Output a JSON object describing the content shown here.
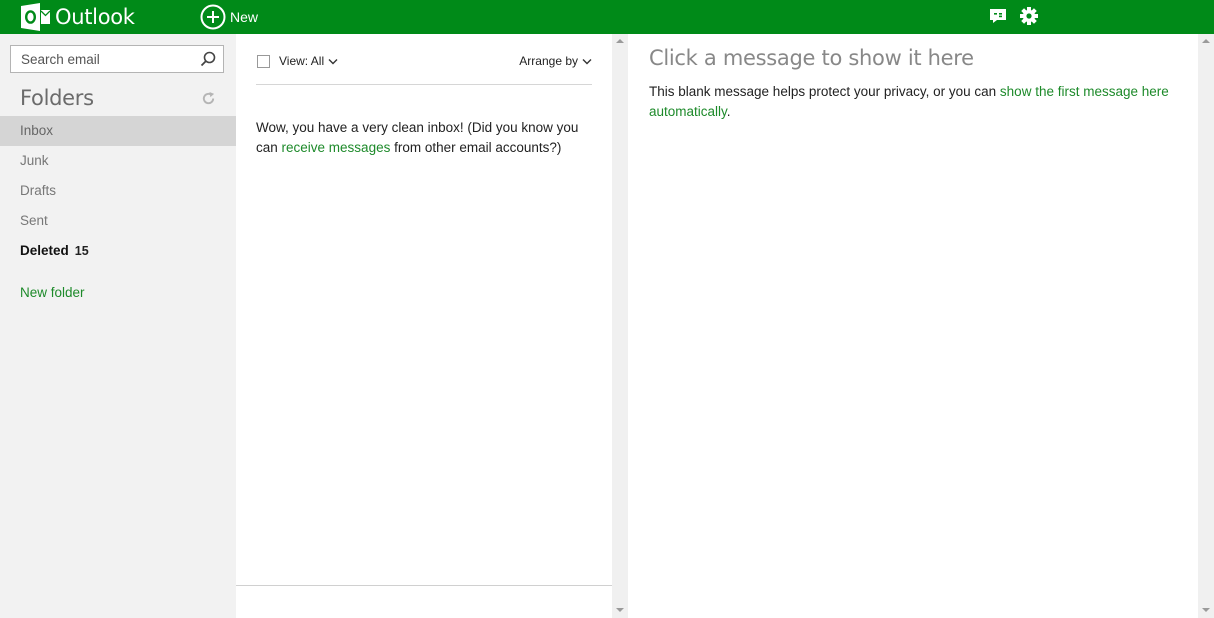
{
  "app": {
    "name": "Outlook",
    "brand_color": "#008a18",
    "link_color": "#1d8a2a"
  },
  "topbar": {
    "logo_icon": "outlook-logo-icon",
    "new_label": "New",
    "new_icon": "plus-circle-icon",
    "right_icons": [
      "chat-icon",
      "gear-icon"
    ]
  },
  "sidebar": {
    "search_placeholder": "Search email",
    "folders_heading": "Folders",
    "folders": [
      {
        "label": "Inbox",
        "selected": true,
        "count": ""
      },
      {
        "label": "Junk",
        "count": ""
      },
      {
        "label": "Drafts",
        "count": ""
      },
      {
        "label": "Sent",
        "count": ""
      },
      {
        "label": "Deleted",
        "count": "15",
        "bold": true
      }
    ],
    "new_folder_label": "New folder"
  },
  "message_list": {
    "view_label": "View: All",
    "arrange_label": "Arrange by",
    "empty_text_1": "Wow, you have a very clean inbox! (Did you know you can ",
    "empty_link": "receive messages",
    "empty_text_2": " from other email accounts?)"
  },
  "reading_pane": {
    "title": "Click a message to show it here",
    "body_text": "This blank message helps protect your privacy, or you can ",
    "body_link": "show the first message here automatically",
    "body_end": "."
  }
}
